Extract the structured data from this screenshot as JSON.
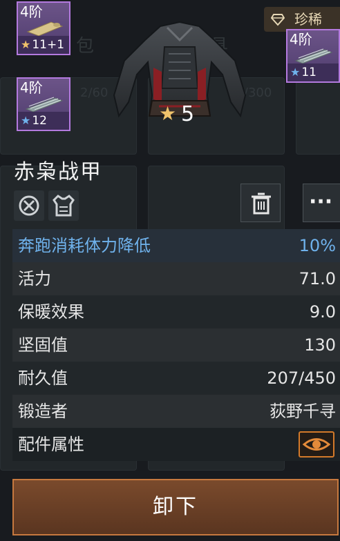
{
  "rarity": {
    "label": "珍稀",
    "icon": "diamond-icon",
    "color": "#e6d7b5"
  },
  "parts": [
    {
      "tier": "4阶",
      "level": "11+1",
      "star_color": "#f0c36b"
    },
    {
      "tier": "4阶",
      "level": "12",
      "star_color": "#6fb2ec"
    },
    {
      "tier": "4阶",
      "level": "11",
      "star_color": "#6fb2ec"
    }
  ],
  "item": {
    "name": "赤枭战甲",
    "star_level": "5"
  },
  "stats": {
    "highlight": {
      "label": "奔跑消耗体力降低",
      "value": "10%"
    },
    "rows": [
      {
        "label": "活力",
        "value": "71.0"
      },
      {
        "label": "保暖效果",
        "value": "9.0"
      },
      {
        "label": "坚固值",
        "value": "130"
      },
      {
        "label": "耐久值",
        "value": "207/450"
      },
      {
        "label": "锻造者",
        "value": "荻野千寻"
      }
    ],
    "parts_label": "配件属性"
  },
  "actions": {
    "unequip_label": "卸下",
    "more_label": "···"
  }
}
